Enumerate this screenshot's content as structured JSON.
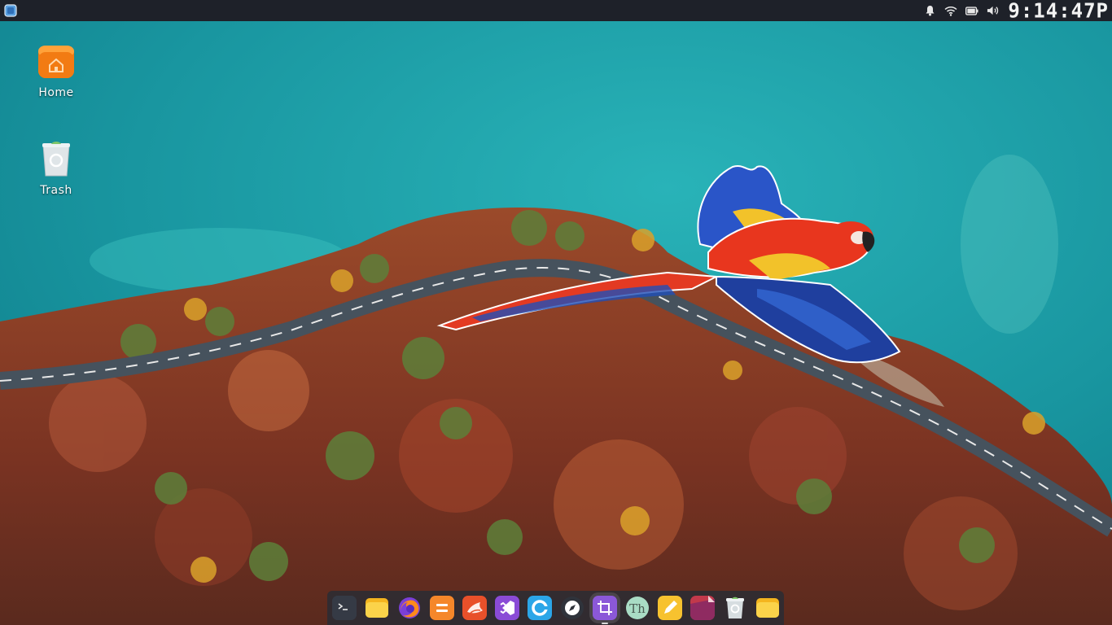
{
  "top_panel": {
    "app_menu_icon": "app-launcher-icon",
    "tray": {
      "icons": [
        "bell-icon",
        "wifi-icon",
        "battery-icon",
        "volume-icon"
      ],
      "clock": "9:14:47P"
    }
  },
  "desktop": {
    "icons": [
      {
        "name": "home",
        "label": "Home",
        "icon": "home-folder-icon"
      },
      {
        "name": "trash",
        "label": "Trash",
        "icon": "trash-bin-icon"
      }
    ]
  },
  "dock": {
    "items": [
      {
        "name": "terminal",
        "icon": "terminal-icon",
        "color": "#3a3f4b"
      },
      {
        "name": "files",
        "icon": "folder-icon",
        "color": "#f6c42b"
      },
      {
        "name": "firefox",
        "icon": "firefox-icon",
        "color": "#7b3fd6"
      },
      {
        "name": "sublime",
        "icon": "sublime-text-icon",
        "color": "#f5872a"
      },
      {
        "name": "app-orange",
        "icon": "bird-app-icon",
        "color": "#e8502a"
      },
      {
        "name": "vscode",
        "icon": "visual-studio-icon",
        "color": "#8a4bd6"
      },
      {
        "name": "app-blue",
        "icon": "c-app-icon",
        "color": "#2ba6e8"
      },
      {
        "name": "compass",
        "icon": "compass-icon",
        "color": "#2f333b"
      },
      {
        "name": "screenshot",
        "icon": "crop-icon",
        "color": "#8b58d8"
      },
      {
        "name": "typography",
        "icon": "font-th-icon",
        "color": "#a9dcc5"
      },
      {
        "name": "notes",
        "icon": "pencil-note-icon",
        "color": "#f7c22f"
      },
      {
        "name": "app-red",
        "icon": "document-red-icon",
        "color": "#c2394b"
      },
      {
        "name": "trash",
        "icon": "trash-bin-icon",
        "color": "#cfd6da"
      },
      {
        "name": "folder",
        "icon": "folder-icon",
        "color": "#f6c42b"
      }
    ]
  },
  "colors": {
    "water": "#1fa0a8",
    "forest": "#8a3b23",
    "road": "#4a5560",
    "panel": "#1e2129"
  }
}
